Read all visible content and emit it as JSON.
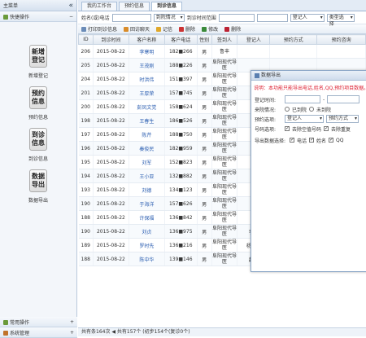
{
  "sidebar": {
    "title": "主菜单",
    "collapse": "«",
    "group_title": "快捷操作",
    "group_toggle": "−",
    "quick": [
      {
        "btn": "新增登记",
        "label": "新增登记"
      },
      {
        "btn": "预约信息",
        "label": "预约信息"
      },
      {
        "btn": "到诊信息",
        "label": "到诊信息"
      },
      {
        "btn": "数据导出",
        "label": "数据导出"
      }
    ],
    "bottom": [
      {
        "label": "常用操作",
        "toggle": "+"
      },
      {
        "label": "系统管理",
        "toggle": "+"
      }
    ]
  },
  "tabs": [
    {
      "label": "我的工作台"
    },
    {
      "label": "预约信息"
    },
    {
      "label": "到诊信息"
    }
  ],
  "search": {
    "name_label": "姓名(或)电话",
    "name_value": "",
    "arrival": "到院情况",
    "time_label": "到诊时间范围",
    "date_from": "",
    "date_to": "",
    "registrar": "登记人",
    "type": "类型选择"
  },
  "toolbar": {
    "print": "打印到诊信息",
    "return_visit": "回访聊天",
    "note": "记信",
    "delete": "删除",
    "edit": "修改",
    "remove": "删除"
  },
  "grid": {
    "columns": [
      "ID",
      "到诊时间",
      "客户名称",
      "客户电话",
      "性别",
      "签到人",
      "登记人",
      "预约方式",
      "预约咨询"
    ],
    "rows": [
      {
        "id": "206",
        "date": "2015-08-22",
        "name": "李寒明",
        "phone": "182■266",
        "sex": "男",
        "sign": "鲁丰",
        "reg": "",
        "way": "",
        "consult": ""
      },
      {
        "id": "205",
        "date": "2015-08-22",
        "name": "王茂刚",
        "phone": "188■226",
        "sex": "男",
        "sign": "阜阳现代导医",
        "reg": "",
        "way": "",
        "consult": ""
      },
      {
        "id": "204",
        "date": "2015-08-22",
        "name": "时洪伟",
        "phone": "151■397",
        "sex": "男",
        "sign": "阜阳现代导医",
        "reg": "",
        "way": "",
        "consult": ""
      },
      {
        "id": "201",
        "date": "2015-08-22",
        "name": "王厚荣",
        "phone": "157■745",
        "sex": "男",
        "sign": "阜阳现代导医",
        "reg": "",
        "way": "",
        "consult": ""
      },
      {
        "id": "200",
        "date": "2015-08-22",
        "name": "彭凤文党",
        "phone": "158■624",
        "sex": "男",
        "sign": "阜阳现代导医",
        "reg": "",
        "way": "",
        "consult": ""
      },
      {
        "id": "198",
        "date": "2015-08-22",
        "name": "王春生",
        "phone": "186■526",
        "sex": "男",
        "sign": "阜阳现代导医",
        "reg": "",
        "way": "",
        "consult": ""
      },
      {
        "id": "197",
        "date": "2015-08-22",
        "name": "陈芹",
        "phone": "188■750",
        "sex": "男",
        "sign": "阜阳现代导医",
        "reg": "",
        "way": "",
        "consult": ""
      },
      {
        "id": "196",
        "date": "2015-08-22",
        "name": "秦俊民",
        "phone": "182■959",
        "sex": "男",
        "sign": "阜阳现代导医",
        "reg": "",
        "way": "",
        "consult": ""
      },
      {
        "id": "195",
        "date": "2015-08-22",
        "name": "刘军",
        "phone": "152■823",
        "sex": "男",
        "sign": "阜阳现代导医",
        "reg": "",
        "way": "",
        "consult": ""
      },
      {
        "id": "194",
        "date": "2015-08-22",
        "name": "王小亚",
        "phone": "132■882",
        "sex": "男",
        "sign": "阜阳现代导医",
        "reg": "",
        "way": "",
        "consult": ""
      },
      {
        "id": "193",
        "date": "2015-08-22",
        "name": "刘德",
        "phone": "134■123",
        "sex": "男",
        "sign": "阜阳现代导医",
        "reg": "",
        "way": "",
        "consult": ""
      },
      {
        "id": "190",
        "date": "2015-08-22",
        "name": "于海洋",
        "phone": "157■626",
        "sex": "男",
        "sign": "阜阳现代导医",
        "reg": "",
        "way": "",
        "consult": ""
      },
      {
        "id": "188",
        "date": "2015-08-22",
        "name": "许保福",
        "phone": "136■842",
        "sex": "男",
        "sign": "阜阳现代导医",
        "reg": "",
        "way": "",
        "consult": ""
      },
      {
        "id": "190",
        "date": "2015-08-22",
        "name": "刘贞",
        "phone": "136■975",
        "sex": "男",
        "sign": "阜阳现代导医",
        "reg": "李静",
        "way": "户外电话",
        "consult": "网络预约"
      },
      {
        "id": "189",
        "date": "2015-08-22",
        "name": "罗时先",
        "phone": "136■216",
        "sex": "男",
        "sign": "阜阳现代导医",
        "reg": "杨小利",
        "way": "户外电话",
        "consult": "网络预约"
      },
      {
        "id": "188",
        "date": "2015-08-22",
        "name": "陈中华",
        "phone": "139■146",
        "sex": "男",
        "sign": "阜阳现代导医",
        "reg": "赵平",
        "way": "商务通(客户)",
        "consult": "网络预约"
      }
    ]
  },
  "footer": "共有条164次  ◀  共有157个  (初步154个(复诊0个)",
  "dialog": {
    "title": "数据导出",
    "notice": "说明：本功能只能导出电话,姓名,QQ,预约项目数据。请",
    "fields": {
      "reg_time": "登记时间:",
      "arrival": "来院情况:",
      "arrived": "已到院",
      "not_arrived": "未到院",
      "appt_type": "预约选项:",
      "appt_value": "登记人",
      "appt_way": "预约方式",
      "phone_opt": "号码选项:",
      "remove_empty": "去除空值号码",
      "remove_dup": "去除重复",
      "export_sel": "导出数据选择:",
      "opt_phone": "电话",
      "opt_name": "姓名",
      "opt_qq": "QQ"
    }
  }
}
